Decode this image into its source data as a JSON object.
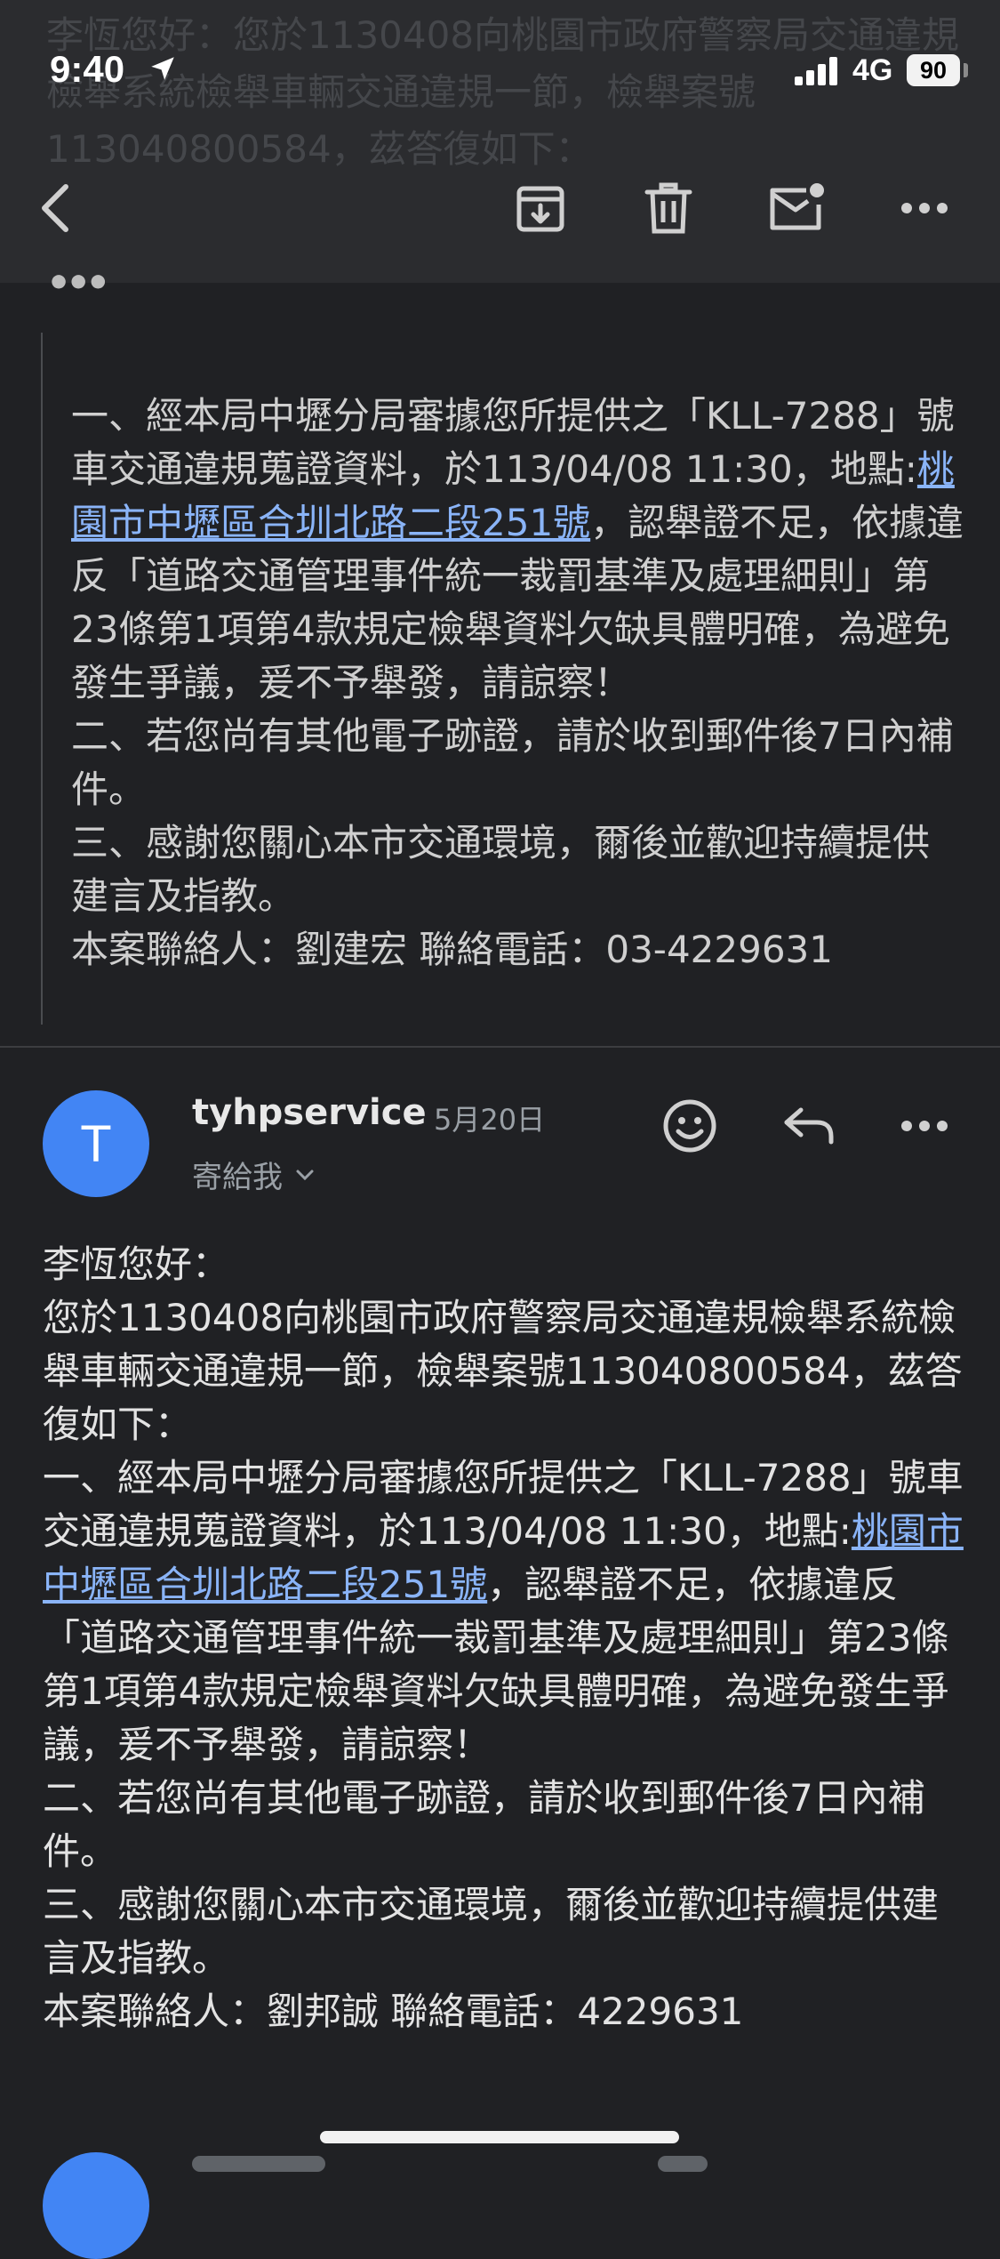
{
  "status_bar": {
    "time": "9:40",
    "network": "4G",
    "battery": "90"
  },
  "background_text": "李恆您好：您於1130408向桃園市政府警察局交通違規檢舉系統檢舉車輛交通違規一節，檢舉案號113040800584，茲答復如下：",
  "toolbar": {
    "back_icon": "chevron-left-icon",
    "archive_icon": "archive-icon",
    "delete_icon": "trash-icon",
    "unread_icon": "mark-unread-icon",
    "more_icon": "more-horizontal-icon"
  },
  "trimmed_content_label": "•••",
  "quoted_message": {
    "p1_before": "一、經本局中壢分局審據您所提供之「KLL-7288」號車交通違規蒐證資料，於113/04/08 11:30，地點:",
    "p1_link": "桃園市中壢區合圳北路二段251號",
    "p1_after": "，認舉證不足，依據違反「道路交通管理事件統一裁罰基準及處理細則」第23條第1項第4款規定檢舉資料欠缺具體明確，為避免發生爭議，爰不予舉發，請諒察！",
    "p2": "二、若您尚有其他電子跡證，請於收到郵件後7日內補件。",
    "p3": "三、感謝您關心本市交通環境，爾後並歡迎持續提供建言及指教。",
    "contact": "本案聯絡人：劉建宏 聯絡電話：03-4229631"
  },
  "message": {
    "avatar_letter": "T",
    "sender": "tyhpservice",
    "date": "5月20日",
    "to_label": "寄給我",
    "emoji_icon": "smiley-icon",
    "reply_icon": "reply-icon",
    "more_icon": "more-horizontal-icon"
  },
  "body": {
    "greeting": "李恆您好：",
    "intro": "您於1130408向桃園市政府警察局交通違規檢舉系統檢舉車輛交通違規一節，檢舉案號113040800584，茲答復如下：",
    "p1_before": "一、經本局中壢分局審據您所提供之「KLL-7288」號車交通違規蒐證資料，於113/04/08 11:30，地點:",
    "p1_link": "桃園市中壢區合圳北路二段251號",
    "p1_after": "，認舉證不足，依據違反「道路交通管理事件統一裁罰基準及處理細則」第23條第1項第4款規定檢舉資料欠缺具體明確，為避免發生爭議，爰不予舉發，請諒察！",
    "p2": "二、若您尚有其他電子跡證，請於收到郵件後7日內補件。",
    "p3": "三、感謝您關心本市交通環境，爾後並歡迎持續提供建言及指教。",
    "contact": "本案聯絡人：劉邦誠 聯絡電話：4229631"
  },
  "colors": {
    "background": "#202124",
    "header": "#2b2c2f",
    "link": "#8ab4f8",
    "avatar": "#4285f4"
  }
}
